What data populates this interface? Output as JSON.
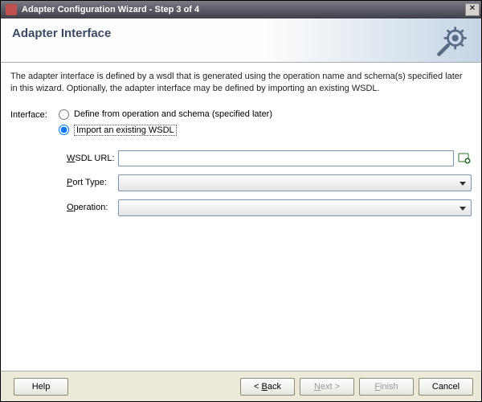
{
  "window": {
    "title": "Adapter Configuration Wizard - Step 3 of 4"
  },
  "header": {
    "title": "Adapter Interface"
  },
  "description": "The adapter interface is defined by a wsdl that is generated using the operation name and schema(s) specified later in this wizard.  Optionally, the adapter interface may be defined by importing an existing WSDL.",
  "interface": {
    "label": "Interface:",
    "option_define": "Define from operation and schema (specified later)",
    "option_import": "Import an existing WSDL"
  },
  "fields": {
    "wsdl_url_label_pre": "W",
    "wsdl_url_label_rest": "SDL URL:",
    "wsdl_url_value": "",
    "port_type_label_pre": "P",
    "port_type_label_rest": "ort Type:",
    "port_type_value": "",
    "operation_label_pre": "O",
    "operation_label_rest": "peration:",
    "operation_value": ""
  },
  "buttons": {
    "help": "Help",
    "back_pre": "< ",
    "back_ul": "B",
    "back_rest": "ack",
    "next_ul": "N",
    "next_rest": "ext >",
    "finish_ul": "F",
    "finish_rest": "inish",
    "cancel": "Cancel"
  }
}
